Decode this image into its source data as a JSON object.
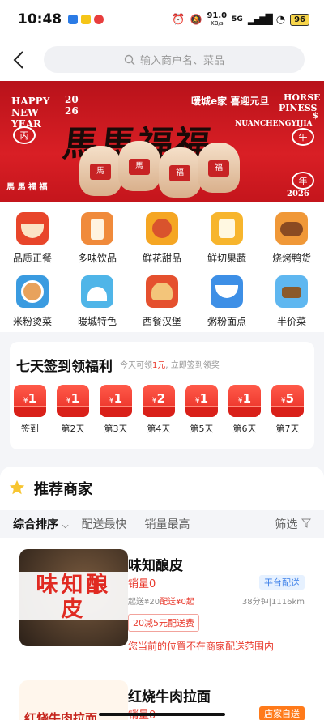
{
  "status_bar": {
    "time": "10:48",
    "net_speed": "91.0",
    "net_unit": "KB/s",
    "signal": "5G",
    "battery": "96"
  },
  "search": {
    "placeholder": "输入商户名、菜品"
  },
  "banner": {
    "happy": "HAPPY",
    "year_top": "20",
    "new": "NEW",
    "year_bottom": "26",
    "year_word": "YEAR",
    "slogan": "暖城e家 喜迎元旦",
    "horse": "HORSE",
    "piness": "PINESS",
    "dollar": "$",
    "pinyin": "NUANCHENGYIJIA",
    "title": "馬馬福福",
    "seal_left": "丙",
    "seal_right": "午",
    "seal_bottom": "年",
    "year": "2026",
    "side_text": "馬 馬 福 福",
    "horse_chars": [
      "馬",
      "馬",
      "福",
      "福"
    ]
  },
  "categories": [
    {
      "label": "品质正餐",
      "color": "#e8452a"
    },
    {
      "label": "多味饮品",
      "color": "#f08a3b"
    },
    {
      "label": "鲜花甜品",
      "color": "#f5a623"
    },
    {
      "label": "鲜切果蔬",
      "color": "#f7b52d"
    },
    {
      "label": "烧烤鸭货",
      "color": "#f09838"
    },
    {
      "label": "米粉烫菜",
      "color": "#3a9be0"
    },
    {
      "label": "暖城特色",
      "color": "#4fb5e8"
    },
    {
      "label": "西餐汉堡",
      "color": "#e5502e"
    },
    {
      "label": "粥粉面点",
      "color": "#3d8fe6"
    },
    {
      "label": "半价菜",
      "color": "#5fb7f0"
    }
  ],
  "signin": {
    "title": "七天签到领福利",
    "sub_prefix": "今天可领",
    "sub_amount": "1元",
    "sub_suffix": ", 立即签到领奖",
    "days": [
      {
        "amount": "1",
        "label": "签到"
      },
      {
        "amount": "1",
        "label": "第2天"
      },
      {
        "amount": "1",
        "label": "第3天"
      },
      {
        "amount": "2",
        "label": "第4天"
      },
      {
        "amount": "1",
        "label": "第5天"
      },
      {
        "amount": "1",
        "label": "第6天"
      },
      {
        "amount": "5",
        "label": "第7天"
      }
    ],
    "currency": "¥"
  },
  "recommend": {
    "title": "推荐商家"
  },
  "sort": {
    "comprehensive": "综合排序",
    "fastest": "配送最快",
    "top_sales": "销量最高",
    "filter": "筛选"
  },
  "shops": [
    {
      "name": "味知酿皮",
      "sales": "销量0",
      "min_order": "起送¥20",
      "delivery_fee": "配送¥0起",
      "time_dist": "38分钟|1116km",
      "tag": "平台配送",
      "promo": "20减5元配送费",
      "notice": "您当前的位置不在商家配送范围内",
      "thumb_text": "味知酿皮"
    },
    {
      "name": "红烧牛肉拉面",
      "sales": "销量0",
      "tag": "店家自送",
      "thumb_text": "红烧牛肉拉面"
    }
  ]
}
